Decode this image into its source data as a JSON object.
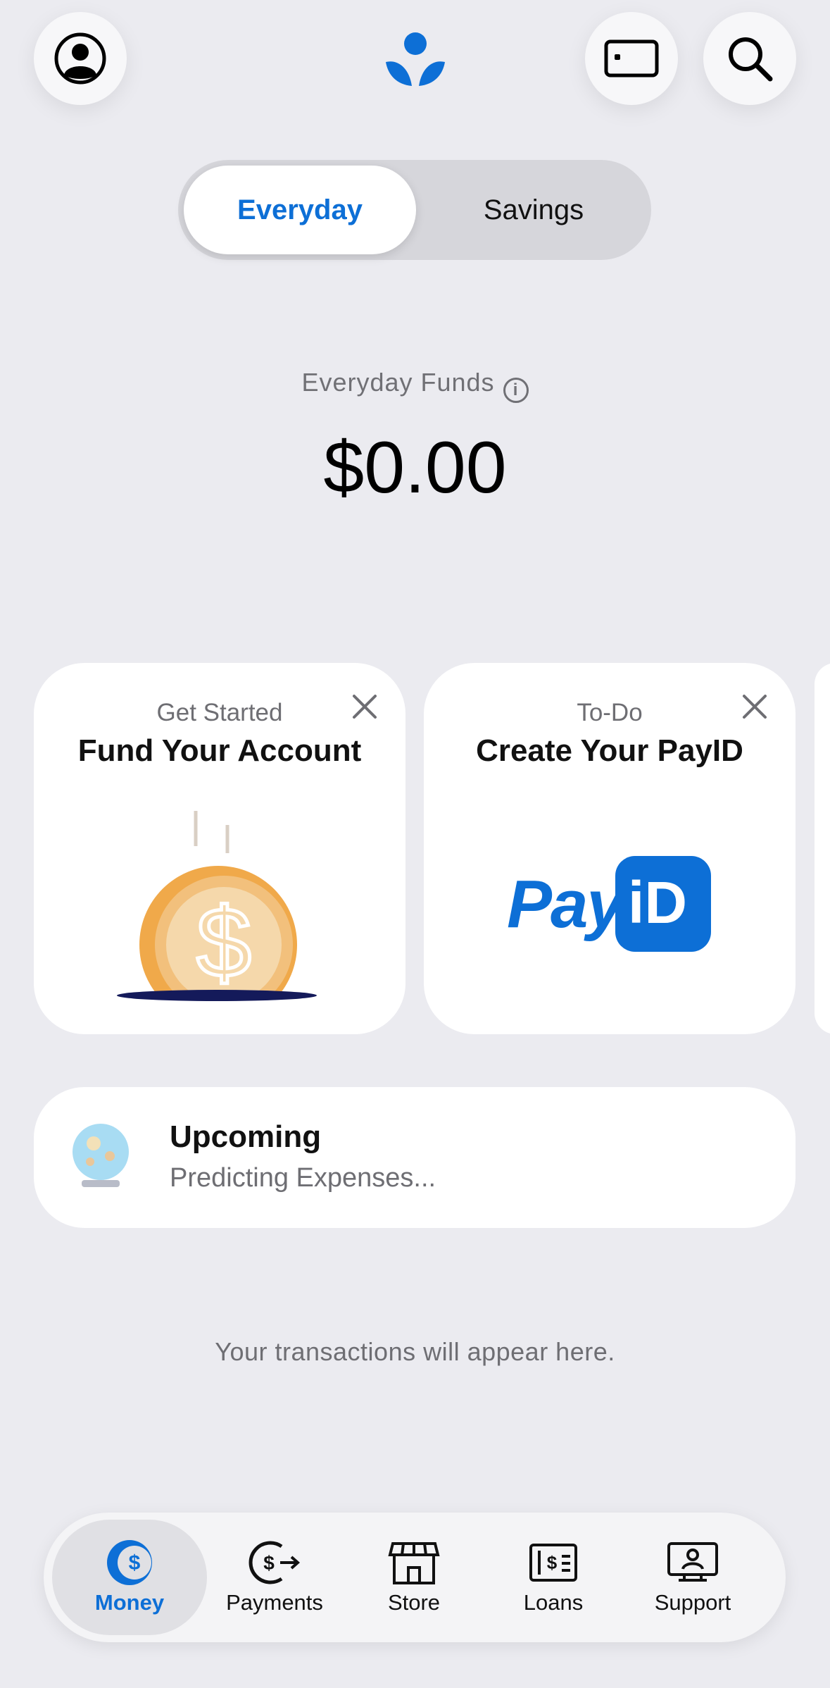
{
  "header": {
    "profile_icon": "person-circle-icon",
    "logo_icon": "bank-logo-icon",
    "card_icon": "card-icon",
    "search_icon": "search-icon",
    "brand_color": "#0d6fd6"
  },
  "segmented": {
    "tabs": [
      "Everyday",
      "Savings"
    ],
    "selected": "Everyday"
  },
  "balance": {
    "label": "Everyday Funds",
    "amount": "$0.00"
  },
  "cards": [
    {
      "kicker": "Get Started",
      "title": "Fund Your Account",
      "illustration": "coin-dollar-icon"
    },
    {
      "kicker": "To-Do",
      "title": "Create Your PayID",
      "illustration": "payid-logo",
      "logo_text": "Pay",
      "logo_badge": "iD"
    }
  ],
  "upcoming": {
    "title": "Upcoming",
    "subtitle": "Predicting Expenses..."
  },
  "empty_state": "Your transactions will appear here.",
  "tabbar": [
    {
      "label": "Money",
      "icon": "dollar-circle-icon",
      "active": true
    },
    {
      "label": "Payments",
      "icon": "dollar-arrow-icon",
      "active": false
    },
    {
      "label": "Store",
      "icon": "storefront-icon",
      "active": false
    },
    {
      "label": "Loans",
      "icon": "bill-icon",
      "active": false
    },
    {
      "label": "Support",
      "icon": "support-desk-icon",
      "active": false
    }
  ]
}
